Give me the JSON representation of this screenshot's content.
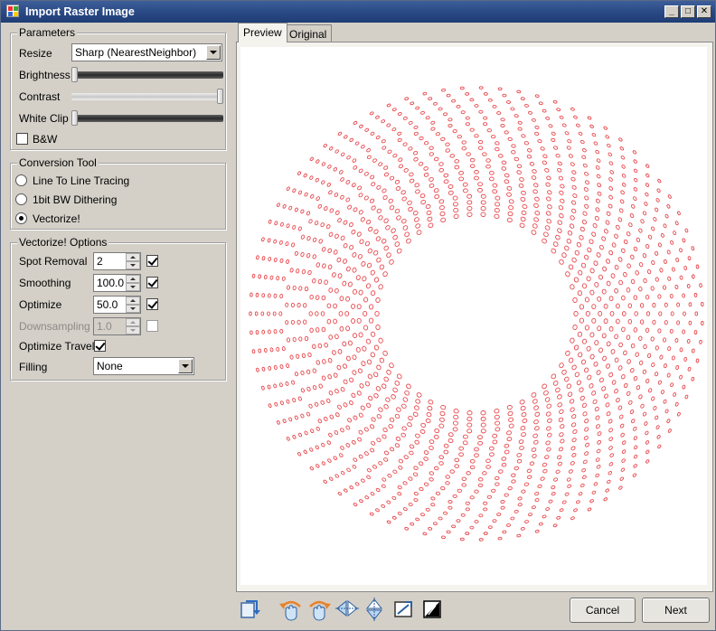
{
  "window": {
    "title": "Import Raster Image"
  },
  "parameters": {
    "legend": "Parameters",
    "resize": {
      "label": "Resize",
      "value": "Sharp (NearestNeighbor)"
    },
    "brightness": {
      "label": "Brightness",
      "level": 0
    },
    "contrast": {
      "label": "Contrast",
      "level": 1
    },
    "white_clip": {
      "label": "White Clip",
      "level": 0
    },
    "bw": {
      "label": "B&W",
      "checked": false
    }
  },
  "conversion": {
    "legend": "Conversion Tool",
    "options": [
      {
        "label": "Line To Line Tracing",
        "selected": false
      },
      {
        "label": "1bit BW Dithering",
        "selected": false
      },
      {
        "label": "Vectorize!",
        "selected": true
      }
    ]
  },
  "vectorize": {
    "legend": "Vectorize! Options",
    "spot_removal": {
      "label": "Spot Removal",
      "value": "2",
      "checked": true
    },
    "smoothing": {
      "label": "Smoothing",
      "value": "100.0",
      "checked": true
    },
    "optimize": {
      "label": "Optimize",
      "value": "50.0",
      "checked": true
    },
    "downsampling": {
      "label": "Downsampling",
      "value": "1.0",
      "checked": false
    },
    "optimize_travel": {
      "label": "Optimize Travel",
      "checked": true
    },
    "filling": {
      "label": "Filling",
      "value": "None"
    }
  },
  "tabs": [
    {
      "label": "Preview",
      "active": true
    },
    {
      "label": "Original",
      "active": false
    }
  ],
  "preview": {
    "dot_color": "#e8464b",
    "rings": 22
  },
  "toolbar": {
    "icons": [
      "reload-icon",
      "rotate-left-icon",
      "rotate-right-icon",
      "flip-horizontal-icon",
      "flip-vertical-icon",
      "crop-icon",
      "invert-icon"
    ]
  },
  "buttons": {
    "cancel": "Cancel",
    "next": "Next"
  }
}
